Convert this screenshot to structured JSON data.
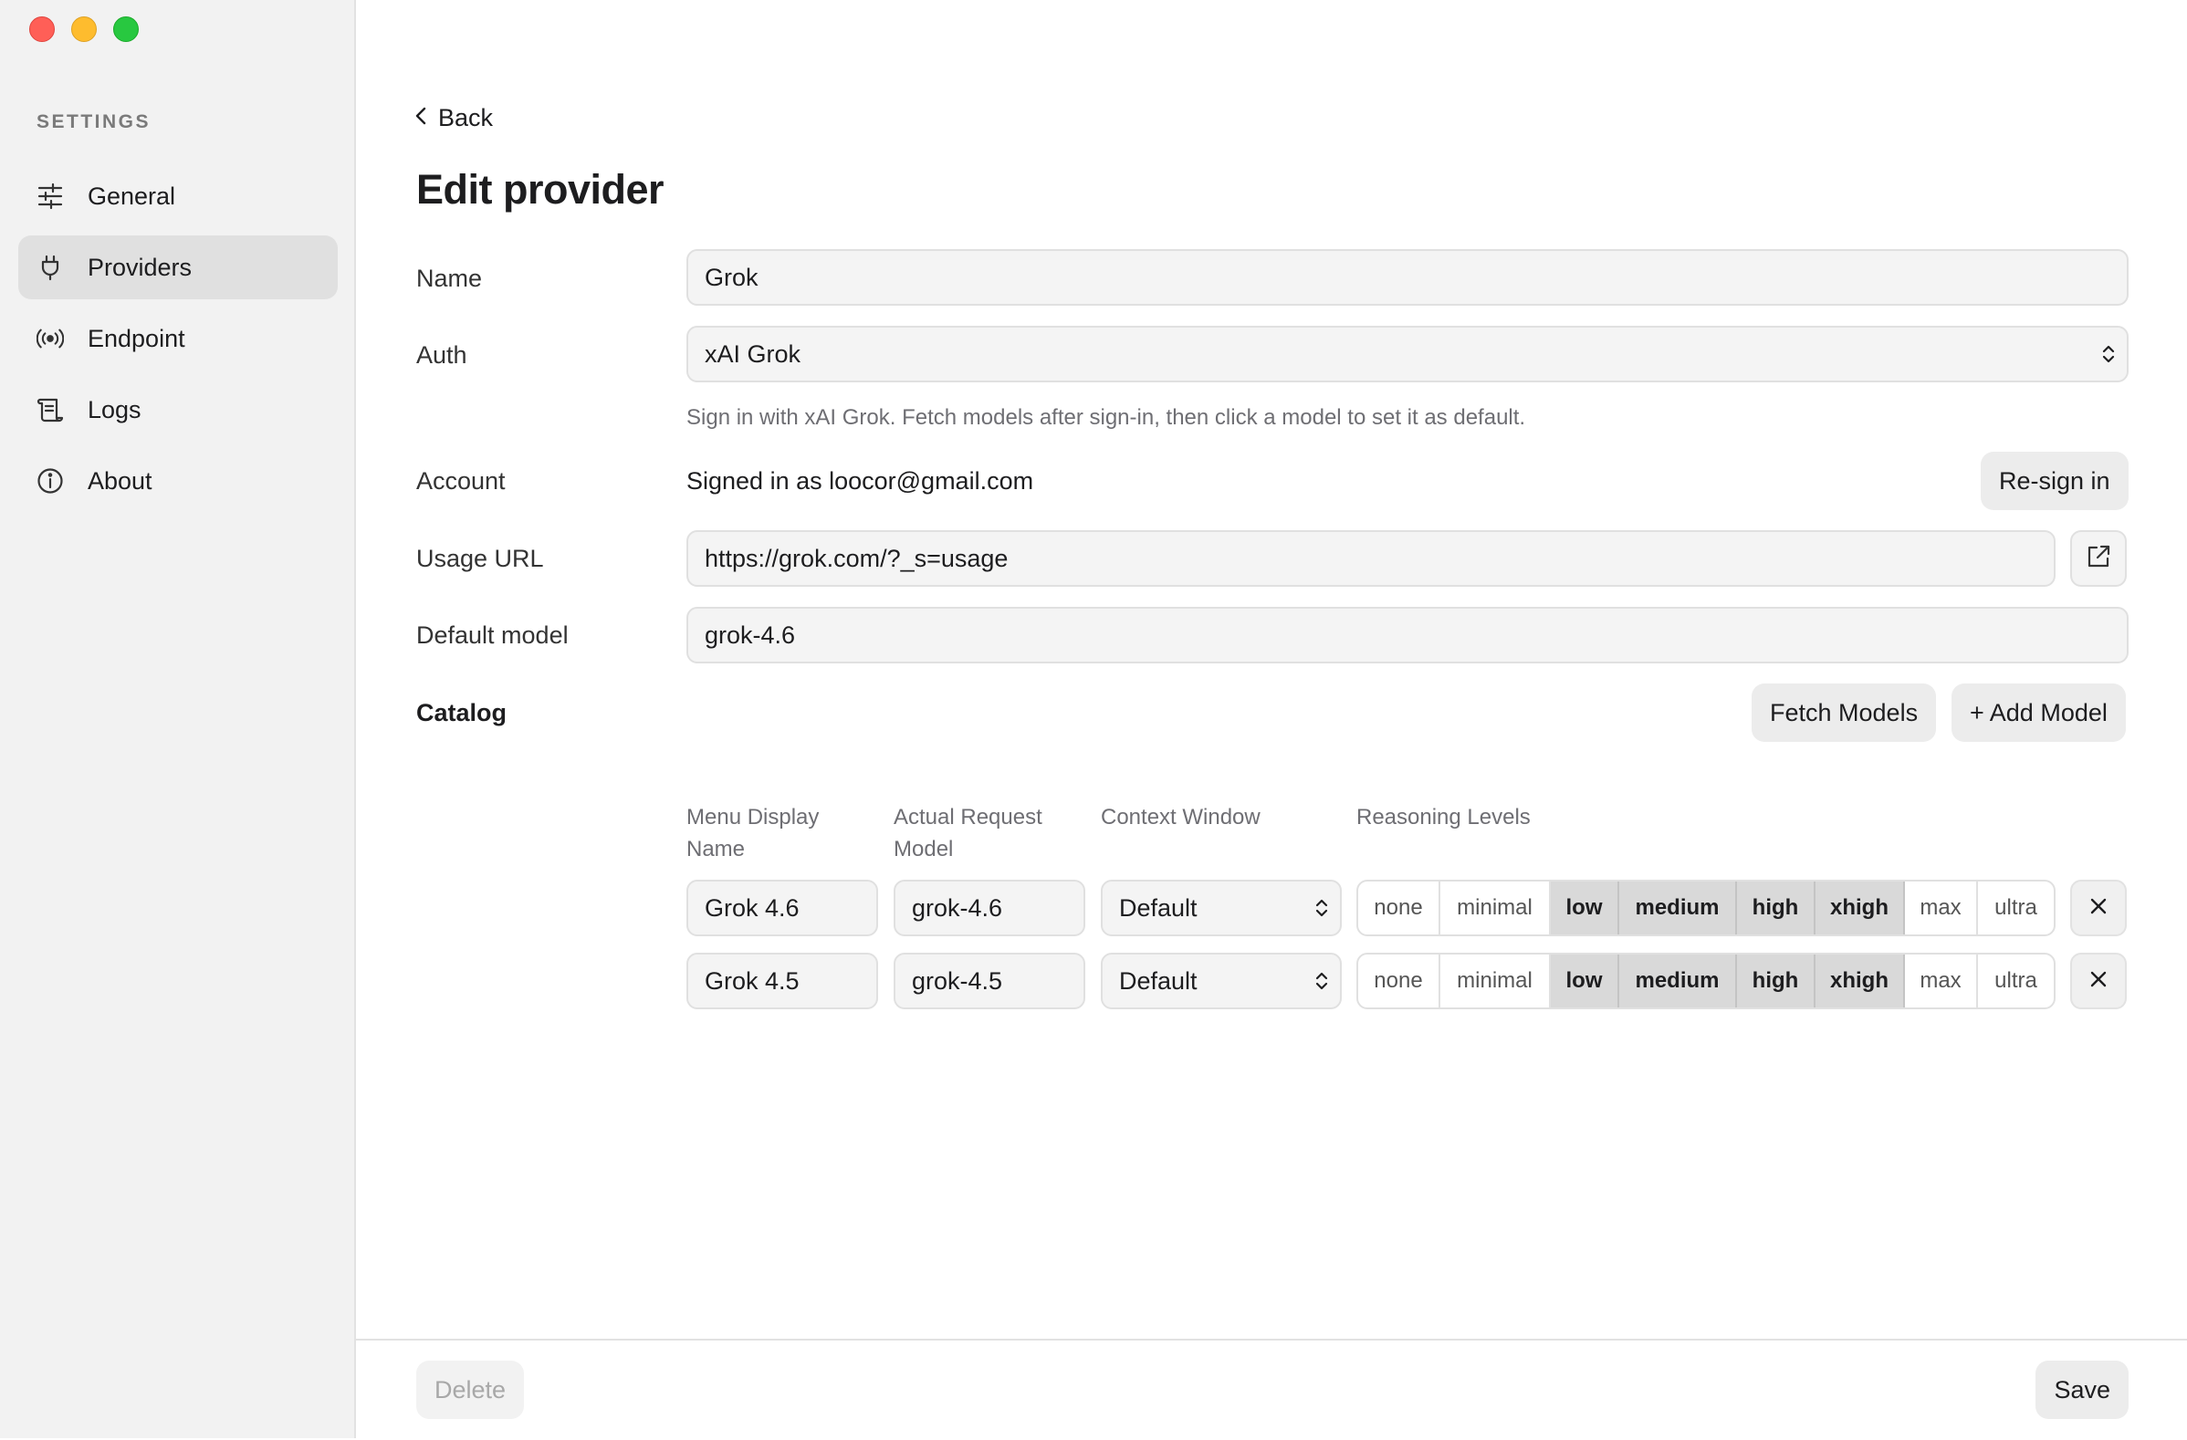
{
  "sidebar": {
    "heading": "SETTINGS",
    "items": [
      {
        "label": "General",
        "icon": "sliders-icon",
        "active": false
      },
      {
        "label": "Providers",
        "icon": "plug-icon",
        "active": true
      },
      {
        "label": "Endpoint",
        "icon": "broadcast-icon",
        "active": false
      },
      {
        "label": "Logs",
        "icon": "scroll-icon",
        "active": false
      },
      {
        "label": "About",
        "icon": "info-icon",
        "active": false
      }
    ]
  },
  "main": {
    "back_label": "Back",
    "title": "Edit provider",
    "name": {
      "label": "Name",
      "value": "Grok"
    },
    "auth": {
      "label": "Auth",
      "value": "xAI Grok",
      "hint": "Sign in with xAI Grok. Fetch models after sign-in, then click a model to set it as default."
    },
    "account": {
      "label": "Account",
      "value": "Signed in as loocor@gmail.com",
      "button": "Re-sign in"
    },
    "usage_url": {
      "label": "Usage URL",
      "value": "https://grok.com/?_s=usage"
    },
    "default_model": {
      "label": "Default model",
      "value": "grok-4.6"
    },
    "catalog": {
      "label": "Catalog",
      "fetch_button": "Fetch Models",
      "add_button": "+ Add Model",
      "columns": {
        "display_name_1": "Menu Display",
        "display_name_2": "Name",
        "request_model_1": "Actual Request",
        "request_model_2": "Model",
        "context_window": "Context Window",
        "reasoning_levels": "Reasoning Levels"
      },
      "levels": [
        "none",
        "minimal",
        "low",
        "medium",
        "high",
        "xhigh",
        "max",
        "ultra"
      ],
      "rows": [
        {
          "display_name": "Grok 4.6",
          "request_model": "grok-4.6",
          "context_window": "Default",
          "selected_levels": [
            "low",
            "medium",
            "high",
            "xhigh"
          ]
        },
        {
          "display_name": "Grok 4.5",
          "request_model": "grok-4.5",
          "context_window": "Default",
          "selected_levels": [
            "low",
            "medium",
            "high",
            "xhigh"
          ]
        }
      ]
    }
  },
  "footer": {
    "delete_label": "Delete",
    "save_label": "Save"
  },
  "colors": {
    "sidebar_bg": "#f2f2f2",
    "active_item": "#e0e0e0",
    "selected_level": "#d9d9d9",
    "traffic_red": "#ff5f57",
    "traffic_yellow": "#febc2e",
    "traffic_green": "#28c840"
  }
}
